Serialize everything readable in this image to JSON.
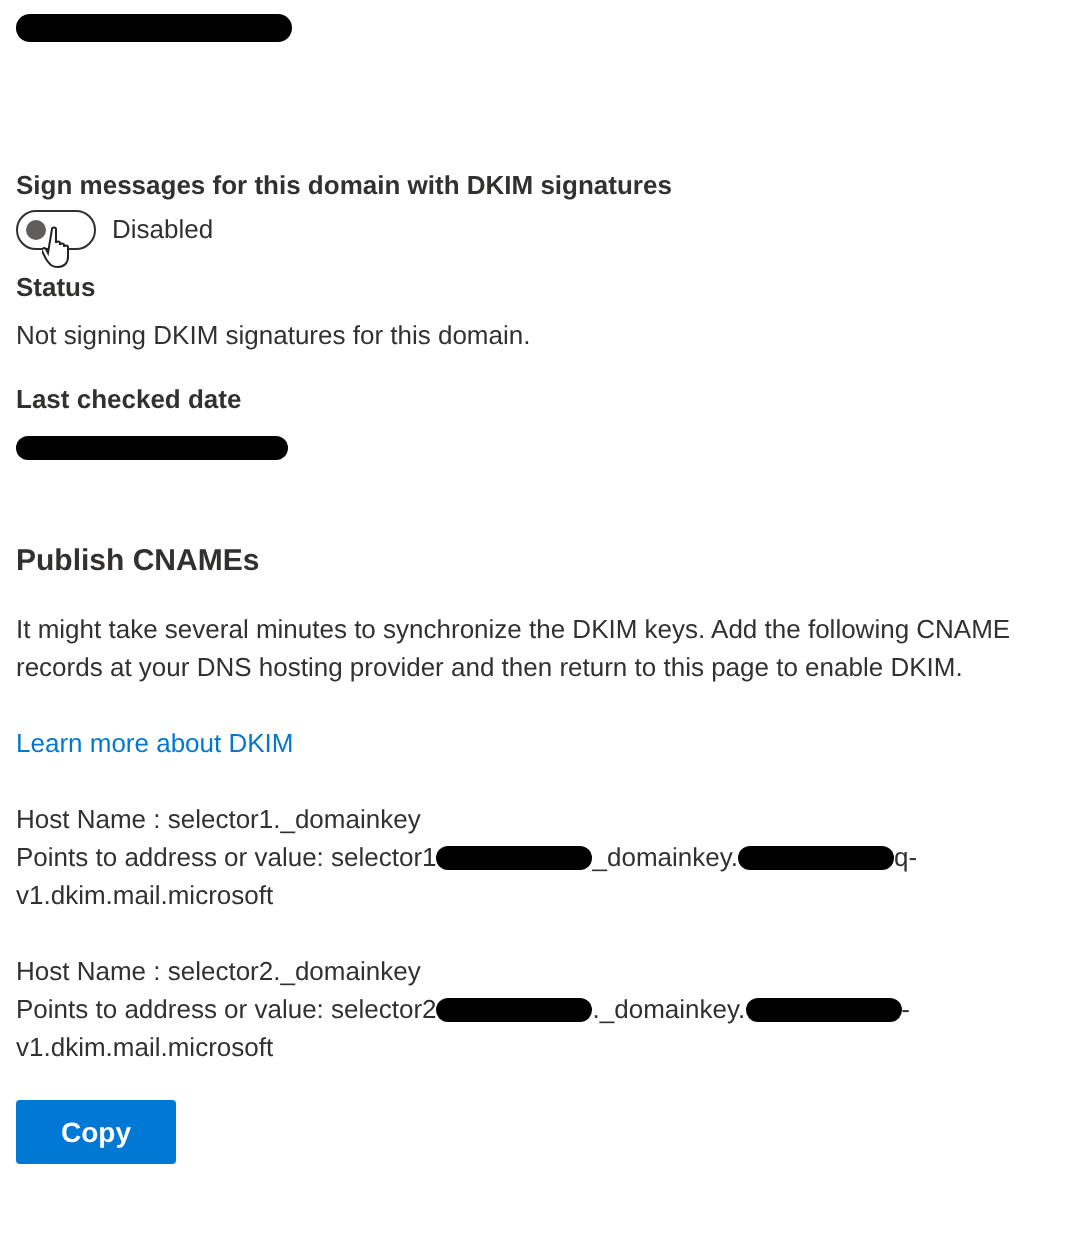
{
  "header": {
    "kind": "redaction"
  },
  "dkim_toggle": {
    "label": "Sign messages for this domain with DKIM signatures",
    "on": false,
    "state_text": "Disabled"
  },
  "status": {
    "label": "Status",
    "value": "Not signing DKIM signatures for this domain."
  },
  "last_checked": {
    "label": "Last checked date",
    "value": {
      "kind": "redaction"
    }
  },
  "publish": {
    "title": "Publish CNAMEs",
    "description": "It might take several minutes to synchronize the DKIM keys. Add the following CNAME records at your DNS hosting provider and then return to this page to enable DKIM.",
    "link": "Learn more about DKIM"
  },
  "records": [
    {
      "host": "Host Name : selector1._domainkey",
      "value_parts": [
        {
          "kind": "text",
          "text": "Points to address or value: selector1"
        },
        {
          "kind": "redaction"
        },
        {
          "kind": "text",
          "text": "_domainkey."
        },
        {
          "kind": "redaction"
        },
        {
          "kind": "text",
          "text": "q-"
        }
      ],
      "value_end": "v1.dkim.mail.microsoft"
    },
    {
      "host": "Host Name : selector2._domainkey",
      "value_parts": [
        {
          "kind": "text",
          "text": "Points to address or value: selector2"
        },
        {
          "kind": "redaction"
        },
        {
          "kind": "text",
          "text": "._domainkey."
        },
        {
          "kind": "redaction"
        },
        {
          "kind": "text",
          "text": "-"
        }
      ],
      "value_end": "v1.dkim.mail.microsoft"
    }
  ],
  "copy_button": "Copy"
}
